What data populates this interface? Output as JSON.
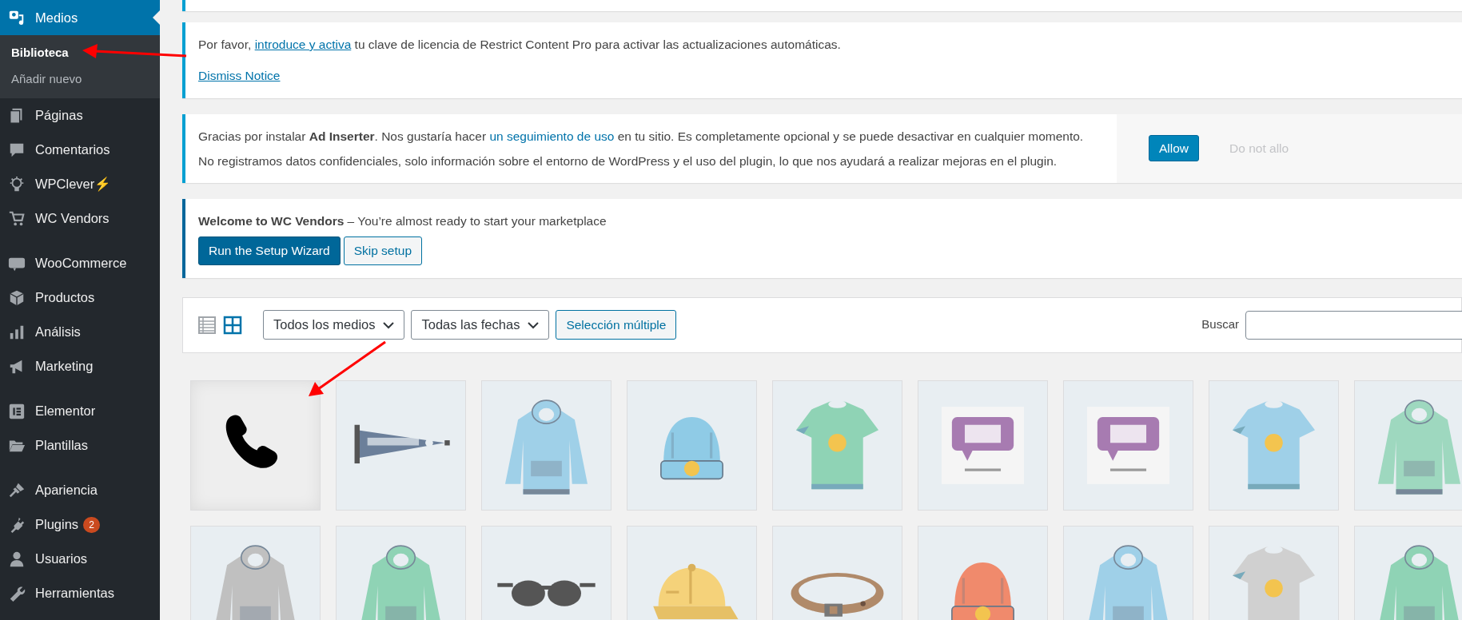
{
  "sidebar": {
    "groups": [
      {
        "items": [
          {
            "label": "Medios",
            "selected": true,
            "children": [
              {
                "label": "Biblioteca",
                "selected": true
              },
              {
                "label": "Añadir nuevo",
                "selected": false
              }
            ]
          },
          {
            "label": "Páginas",
            "selected": false
          },
          {
            "label": "Comentarios",
            "selected": false
          },
          {
            "label": "WPClever⚡",
            "selected": false
          },
          {
            "label": "WC Vendors",
            "selected": false
          }
        ]
      },
      {
        "items": [
          {
            "label": "WooCommerce",
            "selected": false
          },
          {
            "label": "Productos",
            "selected": false
          },
          {
            "label": "Análisis",
            "selected": false
          },
          {
            "label": "Marketing",
            "selected": false
          }
        ]
      },
      {
        "items": [
          {
            "label": "Elementor",
            "selected": false
          },
          {
            "label": "Plantillas",
            "selected": false
          }
        ]
      },
      {
        "items": [
          {
            "label": "Apariencia",
            "selected": false
          },
          {
            "label": "Plugins",
            "selected": false,
            "badge": "2"
          },
          {
            "label": "Usuarios",
            "selected": false
          },
          {
            "label": "Herramientas",
            "selected": false
          }
        ]
      }
    ]
  },
  "notices": [
    {
      "kind": "license",
      "before": "Por favor, ",
      "link": "introduce y activa",
      "after": " tu clave de licencia de Restrict Content Pro para activar las actualizaciones automáticas.",
      "dismiss": "Dismiss Notice"
    },
    {
      "kind": "tracking",
      "line1_before": "Gracias por instalar **Ad Inserter**. Nos gustaría hacer ",
      "line1_link": "un seguimiento de uso",
      "line1_after": " en tu sitio. Es completamente opcional y se puede desactivar en cualquier momento.",
      "line2": "No registramos datos confidenciales, solo información sobre el entorno de WordPress y el uso del plugin, lo que nos ayudará a realizar mejoras en el plugin.",
      "allow": "Allow",
      "deny": "Do not allo"
    },
    {
      "kind": "setup",
      "text": "**Welcome to WC Vendors** – You’re almost ready to start your marketplace",
      "primary": "Run the Setup Wizard",
      "secondary": "Skip setup"
    }
  ],
  "toolbar": {
    "view_modes": [
      {
        "kind": "list",
        "selected": false
      },
      {
        "kind": "grid",
        "selected": true
      }
    ],
    "filters": [
      "Todos los medios",
      "Todas las fechas"
    ],
    "bulk_button": "Selección múltiple",
    "search_label": "Buscar"
  },
  "media": [
    {
      "kind": "icon"
    },
    {
      "kind": "picture"
    },
    {
      "kind": "picture"
    },
    {
      "kind": "picture"
    },
    {
      "kind": "picture"
    },
    {
      "kind": "picture"
    },
    {
      "kind": "picture"
    },
    {
      "kind": "picture"
    },
    {
      "kind": "picture"
    },
    {
      "kind": "picture"
    },
    {
      "kind": "picture"
    },
    {
      "kind": "picture"
    },
    {
      "kind": "picture"
    },
    {
      "kind": "picture"
    },
    {
      "kind": "picture"
    },
    {
      "kind": "picture"
    },
    {
      "kind": "picture"
    },
    {
      "kind": "picture"
    }
  ]
}
